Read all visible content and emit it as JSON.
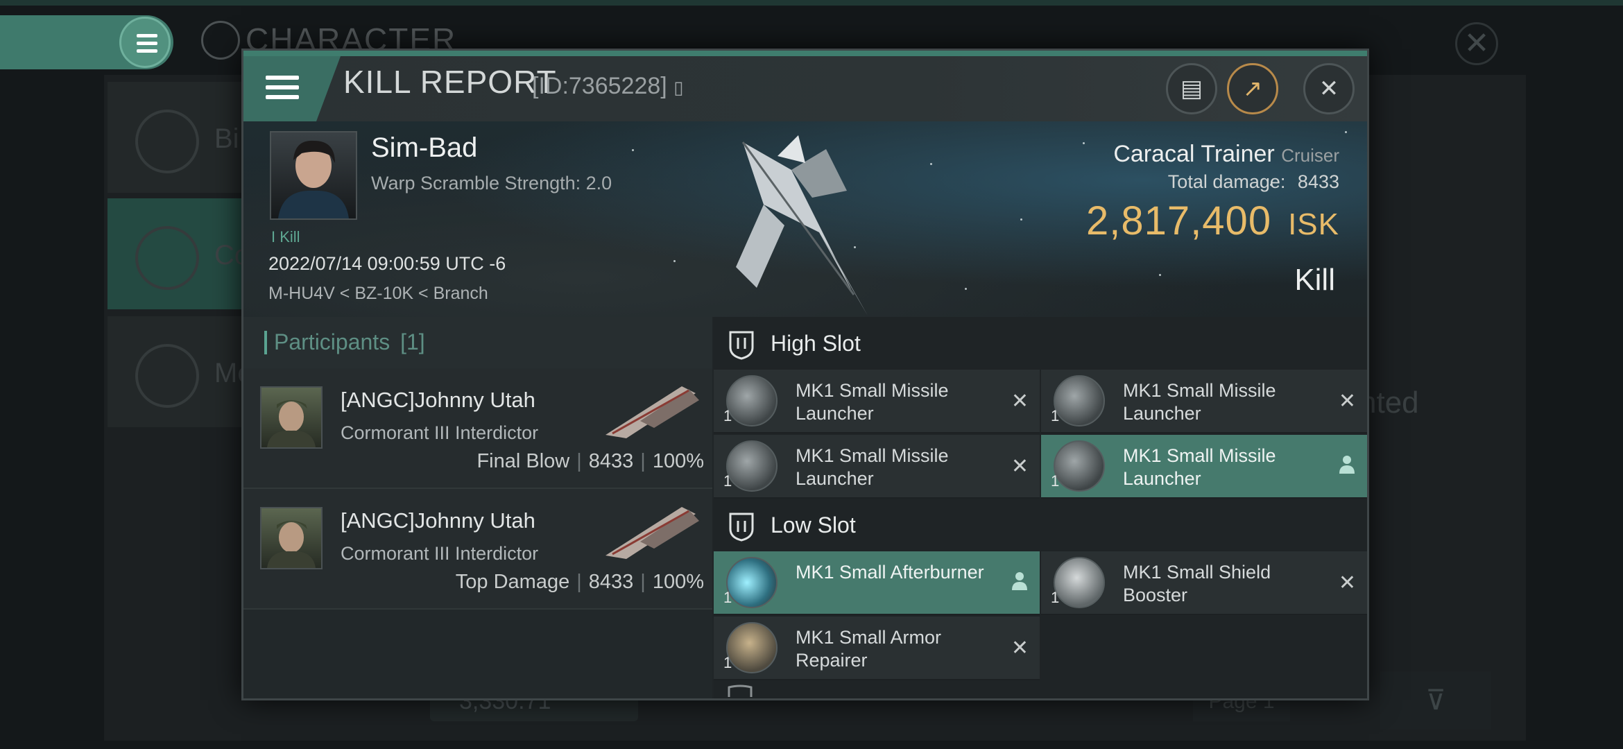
{
  "background": {
    "title": "CHARACTER",
    "side_items": [
      "Bi",
      "Co",
      "Me"
    ],
    "right_text": "nted",
    "bottom_value": "3,330.71",
    "page_label": "Page 1"
  },
  "modal": {
    "title": "KILL REPORT",
    "id_label": "[ID:7365228]",
    "victim": {
      "name": "Sim-Bad",
      "warp_scramble": "Warp Scramble Strength: 2.0",
      "kill_tag": "I Kill",
      "date": "2022/07/14 09:00:59 UTC -6",
      "location": "M-HU4V < BZ-10K < Branch"
    },
    "ship": {
      "name": "Caracal Trainer",
      "class": "Cruiser",
      "total_damage_label": "Total damage:",
      "total_damage": "8433",
      "isk_value": "2,817,400",
      "isk_unit": "ISK",
      "result": "Kill"
    },
    "participants": {
      "title": "Participants",
      "count": "[1]",
      "rows": [
        {
          "name": "[ANGC]Johnny Utah",
          "ship": "Cormorant III Interdictor",
          "role": "Final Blow",
          "damage": "8433",
          "percent": "100%"
        },
        {
          "name": "[ANGC]Johnny Utah",
          "ship": "Cormorant III Interdictor",
          "role": "Top Damage",
          "damage": "8433",
          "percent": "100%"
        }
      ]
    },
    "high_slot": {
      "title": "High Slot",
      "modules": [
        {
          "qty": "1",
          "name": "MK1 Small Missile Launcher",
          "state": "destroyed"
        },
        {
          "qty": "1",
          "name": "MK1 Small Missile Launcher",
          "state": "destroyed"
        },
        {
          "qty": "1",
          "name": "MK1 Small Missile Launcher",
          "state": "destroyed"
        },
        {
          "qty": "1",
          "name": "MK1 Small Missile Launcher",
          "state": "dropped"
        }
      ]
    },
    "low_slot": {
      "title": "Low Slot",
      "modules": [
        {
          "qty": "1",
          "name": "MK1 Small Afterburner",
          "state": "dropped"
        },
        {
          "qty": "1",
          "name": "MK1 Small Shield Booster",
          "state": "destroyed"
        },
        {
          "qty": "1",
          "name": "MK1 Small Armor Repairer",
          "state": "destroyed"
        }
      ]
    },
    "colors": {
      "accent": "#467a6d",
      "isk": "#e8bb69",
      "participants_title": "#5e8f84"
    },
    "icons": {
      "destroyed": "x-icon",
      "dropped": "person-icon"
    }
  }
}
